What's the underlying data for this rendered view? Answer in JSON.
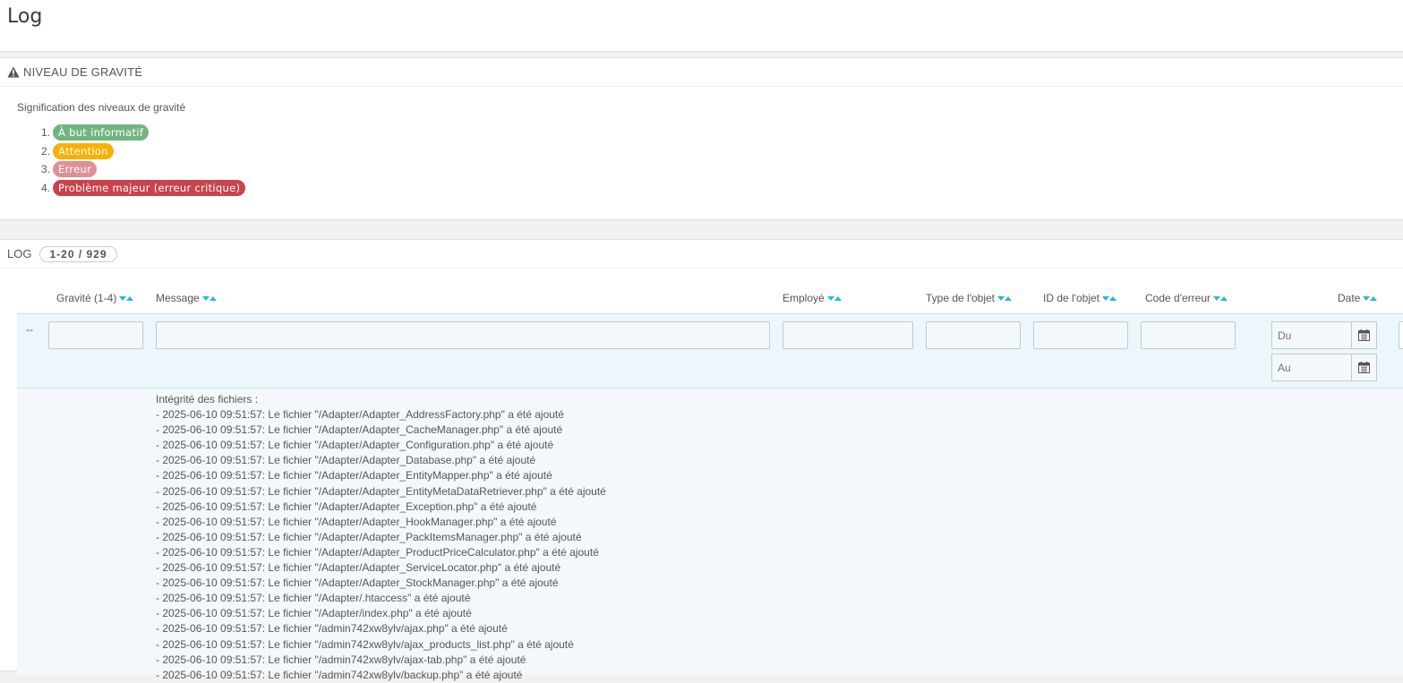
{
  "page": {
    "title": "Log"
  },
  "severity_panel": {
    "heading": "NIVEAU DE GRAVITÉ",
    "intro": "Signification des niveaux de gravité",
    "levels": [
      {
        "num": "1.",
        "label": "À but informatif",
        "color": "#70b580"
      },
      {
        "num": "2.",
        "label": "Attention",
        "color": "#fab000"
      },
      {
        "num": "3.",
        "label": "Erreur",
        "color": "#e08f95"
      },
      {
        "num": "4.",
        "label": "Problème majeur (erreur critique)",
        "color": "#c8434b"
      }
    ]
  },
  "log_panel": {
    "heading": "LOG",
    "count": "1-20 / 929",
    "columns": {
      "severity": "Gravité (1-4)",
      "message": "Message",
      "employee": "Employé",
      "object_type": "Type de l'objet",
      "object_id": "ID de l'objet",
      "error_code": "Code d'erreur",
      "date": "Date"
    },
    "filters": {
      "dash": "--",
      "date_from_placeholder": "Du",
      "date_to_placeholder": "Au"
    },
    "row_message": [
      "Intégrité des fichiers :",
      "- 2025-06-10 09:51:57: Le fichier \"/Adapter/Adapter_AddressFactory.php\" a été ajouté",
      "- 2025-06-10 09:51:57: Le fichier \"/Adapter/Adapter_CacheManager.php\" a été ajouté",
      "- 2025-06-10 09:51:57: Le fichier \"/Adapter/Adapter_Configuration.php\" a été ajouté",
      "- 2025-06-10 09:51:57: Le fichier \"/Adapter/Adapter_Database.php\" a été ajouté",
      "- 2025-06-10 09:51:57: Le fichier \"/Adapter/Adapter_EntityMapper.php\" a été ajouté",
      "- 2025-06-10 09:51:57: Le fichier \"/Adapter/Adapter_EntityMetaDataRetriever.php\" a été ajouté",
      "- 2025-06-10 09:51:57: Le fichier \"/Adapter/Adapter_Exception.php\" a été ajouté",
      "- 2025-06-10 09:51:57: Le fichier \"/Adapter/Adapter_HookManager.php\" a été ajouté",
      "- 2025-06-10 09:51:57: Le fichier \"/Adapter/Adapter_PackItemsManager.php\" a été ajouté",
      "- 2025-06-10 09:51:57: Le fichier \"/Adapter/Adapter_ProductPriceCalculator.php\" a été ajouté",
      "- 2025-06-10 09:51:57: Le fichier \"/Adapter/Adapter_ServiceLocator.php\" a été ajouté",
      "- 2025-06-10 09:51:57: Le fichier \"/Adapter/Adapter_StockManager.php\" a été ajouté",
      "- 2025-06-10 09:51:57: Le fichier \"/Adapter/.htaccess\" a été ajouté",
      "- 2025-06-10 09:51:57: Le fichier \"/Adapter/index.php\" a été ajouté",
      "- 2025-06-10 09:51:57: Le fichier \"/admin742xw8ylv/ajax.php\" a été ajouté",
      "- 2025-06-10 09:51:57: Le fichier \"/admin742xw8ylv/ajax_products_list.php\" a été ajouté",
      "- 2025-06-10 09:51:57: Le fichier \"/admin742xw8ylv/ajax-tab.php\" a été ajouté",
      "- 2025-06-10 09:51:57: Le fichier \"/admin742xw8ylv/backup.php\" a été ajouté"
    ]
  },
  "icons": {
    "warning": "warning-triangle-icon",
    "calendar": "calendar-icon",
    "sort": "sort-arrows-icon"
  },
  "colors": {
    "accent": "#25b9d7",
    "filter_bg": "#ecf6fb"
  }
}
